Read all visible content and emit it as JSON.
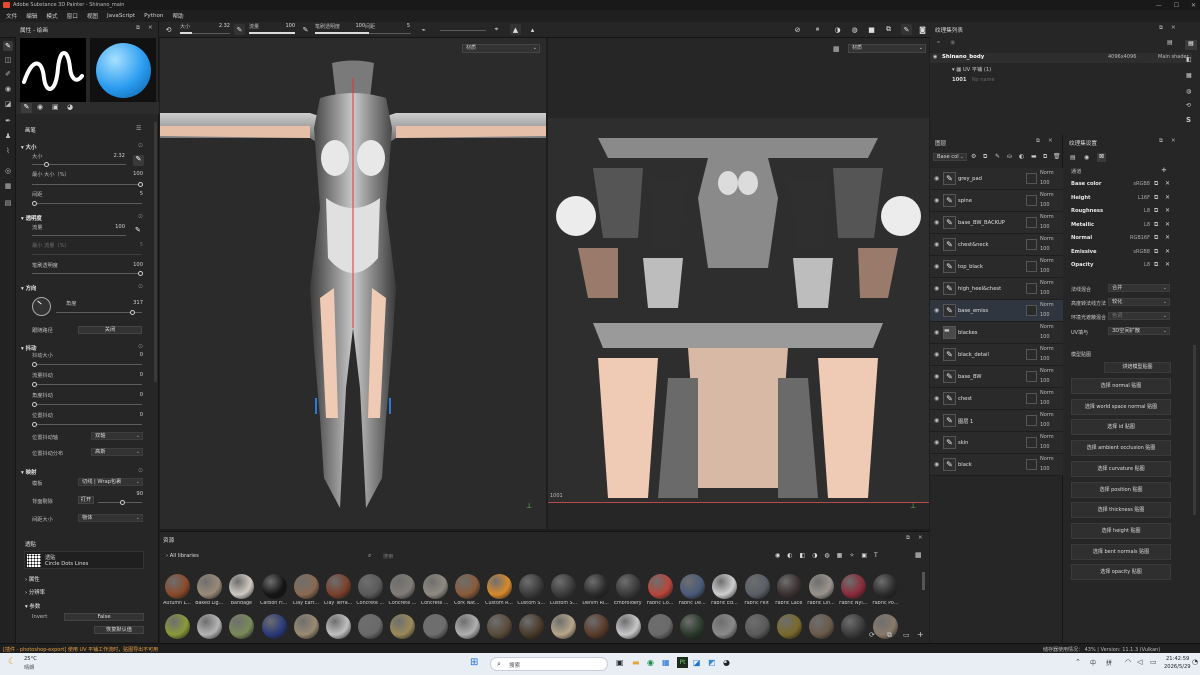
{
  "app": {
    "title": "Adobe Substance 3D Painter - Shinano_main"
  },
  "menu": [
    "文件",
    "编辑",
    "模式",
    "窗口",
    "视图",
    "JavaScript",
    "Python",
    "帮助"
  ],
  "toolbar": {
    "size_label": "大小",
    "size_value": "2.32",
    "flow_label": "流量",
    "flow_value": "100",
    "stroke_opacity_label": "笔刷透明度",
    "stroke_opacity_value": "100",
    "spacing_label": "间距",
    "spacing_value": "5"
  },
  "properties": {
    "title": "属性 - 绘画",
    "brush_header": "画笔",
    "size": {
      "title": "大小",
      "label": "大小",
      "value": "2.32",
      "min_label": "最小 大小（%）",
      "min_value": "100",
      "spacing_label": "间距",
      "spacing_value": "5"
    },
    "opacity": {
      "title": "透明度",
      "flow_label": "流量",
      "flow_value": "100",
      "min_flow_label": "最小 流量（%）",
      "min_flow_value": "5",
      "stroke_opacity_label": "笔刷透明度",
      "stroke_opacity_value": "100"
    },
    "direction": {
      "title": "方向",
      "angle_label": "角度",
      "angle_value": "317",
      "follow_path_label": "跟随路径",
      "follow_path_value": "关闭"
    },
    "jitter": {
      "title": "抖动",
      "size_label": "抖动大小",
      "size_value": "0",
      "flow_label": "流量抖动",
      "flow_value": "0",
      "angle_label": "角度抖动",
      "angle_value": "0",
      "position_label": "位置抖动",
      "position_value": "0",
      "pos_axis_label": "位置抖动轴",
      "pos_axis_value": "双轴",
      "pos_dist_label": "位置抖动分布",
      "pos_dist_value": "高斯"
    },
    "projection": {
      "title": "映射",
      "wrap_label": "模板",
      "wrap_value": "切线 | Wrap包裹",
      "backface_label": "背面剔除",
      "backface_toggle": "打开",
      "backface_value": "90",
      "size_space_label": "间距大小",
      "size_space_value": "物体"
    },
    "alpha": {
      "title": "透贴",
      "name": "透贴",
      "sub": "Circle Dots Lines"
    },
    "sub_attrs": "属性",
    "sub_res": "分辨率",
    "params": {
      "title": "参数",
      "invert_label": "Invert",
      "invert_value": "False",
      "reset_label": "恢复默认值"
    }
  },
  "viewport3d": {
    "mode": "材质"
  },
  "viewport2d": {
    "mode": "材质",
    "udim": "1001"
  },
  "texture_sets": {
    "title": "纹理集列表",
    "set_name": "Shinano_body",
    "resolution": "4096x4096",
    "shader": "Main shader",
    "uv_label": "UV 平铺 (1)",
    "uv_tile": "1001",
    "uv_tile_name": "No name"
  },
  "layers": {
    "title": "图层",
    "channel": "Base col",
    "items": [
      {
        "name": "grey_pad",
        "blend": "Norm",
        "opacity": "100"
      },
      {
        "name": "spine",
        "blend": "Norm",
        "opacity": "100"
      },
      {
        "name": "base_BW_BACKUP",
        "blend": "Norm",
        "opacity": "100"
      },
      {
        "name": "chest&neck",
        "blend": "Norm",
        "opacity": "100"
      },
      {
        "name": "top_black",
        "blend": "Norm",
        "opacity": "100"
      },
      {
        "name": "high_heel&chest",
        "blend": "Norm",
        "opacity": "100"
      },
      {
        "name": "base_emiss",
        "blend": "Norm",
        "opacity": "100"
      },
      {
        "name": "blackes",
        "blend": "Norm",
        "opacity": "100"
      },
      {
        "name": "black_detail",
        "blend": "Norm",
        "opacity": "100"
      },
      {
        "name": "base_BW",
        "blend": "Norm",
        "opacity": "100"
      },
      {
        "name": "chest",
        "blend": "Norm",
        "opacity": "100"
      },
      {
        "name": "图层 1",
        "blend": "Norm",
        "opacity": "100"
      },
      {
        "name": "skin",
        "blend": "Norm",
        "opacity": "100"
      },
      {
        "name": "black",
        "blend": "Norm",
        "opacity": "100"
      }
    ]
  },
  "texture_settings": {
    "title": "纹理集设置",
    "channels_label": "通道",
    "channels": [
      {
        "name": "Base color",
        "format": "sRGB8"
      },
      {
        "name": "Height",
        "format": "L16F"
      },
      {
        "name": "Roughness",
        "format": "L8"
      },
      {
        "name": "Metallic",
        "format": "L8"
      },
      {
        "name": "Normal",
        "format": "RGB16F"
      },
      {
        "name": "Emissive",
        "format": "sRGB8"
      },
      {
        "name": "Opacity",
        "format": "L8"
      }
    ],
    "normal_mix_label": "法线混合",
    "normal_mix_value": "合并",
    "ao_from_label": "高度转法线方法",
    "ao_from_value": "较化",
    "occlusion_label": "环境光遮蔽混合",
    "occlusion_value": "色调",
    "uv_pad_label": "UV填与",
    "uv_pad_value": "3D空间扩散",
    "model_maps_label": "模型贴图",
    "bake_button": "烘焙模型贴图",
    "maps": [
      "选择 normal 贴图",
      "选择 world space normal 贴图",
      "选择 id 贴图",
      "选择 ambient occlusion 贴图",
      "选择 curvature 贴图",
      "选择 position 贴图",
      "选择 thickness 贴图",
      "选择 height 贴图",
      "选择 bent normals 贴图",
      "选择 opacity 贴图"
    ]
  },
  "assets": {
    "title": "资源",
    "library": "All libraries",
    "search_placeholder": "搜索",
    "row1": [
      {
        "label": "Autumn L...",
        "color": "#8a4a2a"
      },
      {
        "label": "Baked Lig...",
        "color": "#9a8a78"
      },
      {
        "label": "Bandage",
        "color": "#cfcac2"
      },
      {
        "label": "Carbon Fi...",
        "color": "#151515"
      },
      {
        "label": "Clay Eart...",
        "color": "#8a6a52"
      },
      {
        "label": "Clay Terra...",
        "color": "#7a3f2a"
      },
      {
        "label": "Concrete ...",
        "color": "#5a5a5c"
      },
      {
        "label": "Concrete ...",
        "color": "#807c78"
      },
      {
        "label": "Concrete ...",
        "color": "#8f8b82"
      },
      {
        "label": "Cork Nat...",
        "color": "#8a5a3a"
      },
      {
        "label": "Custom R...",
        "color": "#d98a2a"
      },
      {
        "label": "Custom S...",
        "color": "#3a3a3a"
      },
      {
        "label": "Custom S...",
        "color": "#3a3a3a"
      },
      {
        "label": "Denim Ri...",
        "color": "#2a2a2a"
      },
      {
        "label": "Embroidery",
        "color": "#3a3a3a"
      },
      {
        "label": "Fabric Co...",
        "color": "#b8453a"
      },
      {
        "label": "Fabric De...",
        "color": "#4a5a7a"
      },
      {
        "label": "Fabric Ed...",
        "color": "#cfcfcf"
      },
      {
        "label": "Fabric Felt",
        "color": "#5a5e66"
      },
      {
        "label": "Fabric Lace",
        "color": "#3a3030"
      },
      {
        "label": "Fabric Lin...",
        "color": "#9a948c"
      },
      {
        "label": "Fabric Nyl...",
        "color": "#8a2a3a"
      },
      {
        "label": "Fabric Po...",
        "color": "#2a2a2a"
      }
    ],
    "row2_colors": [
      "#8a9a3a",
      "#b5b5b5",
      "#7a8a5a",
      "#2a3a7a",
      "#9a8a72",
      "#c0c0c0",
      "#6a6a6a",
      "#9a8a5a",
      "#6e6e6e",
      "#b0b0b0",
      "#5a4a3a",
      "#4a3a2a",
      "#b7a68a",
      "#5a3a2a",
      "#c8c8c8",
      "#6a6a6a",
      "#2a3a2a",
      "#8a8a8a",
      "#5a5a5a",
      "#7a6a2a",
      "#6a5a4a",
      "#3a3a3a",
      "#8a7a6a"
    ]
  },
  "status": {
    "message": "[插件 - photoshop-export] 使用 UV 平铺工作流时，贴图导出不可用",
    "right": "储存器使用情况： 43% | Version: 11.1.3 (Vulkan)"
  },
  "taskbar": {
    "temp": "25°C",
    "weather": "晴朗",
    "search": "搜索",
    "ime1": "中",
    "ime2": "拼",
    "time": "21:42:59",
    "date": "2026/5/29"
  }
}
